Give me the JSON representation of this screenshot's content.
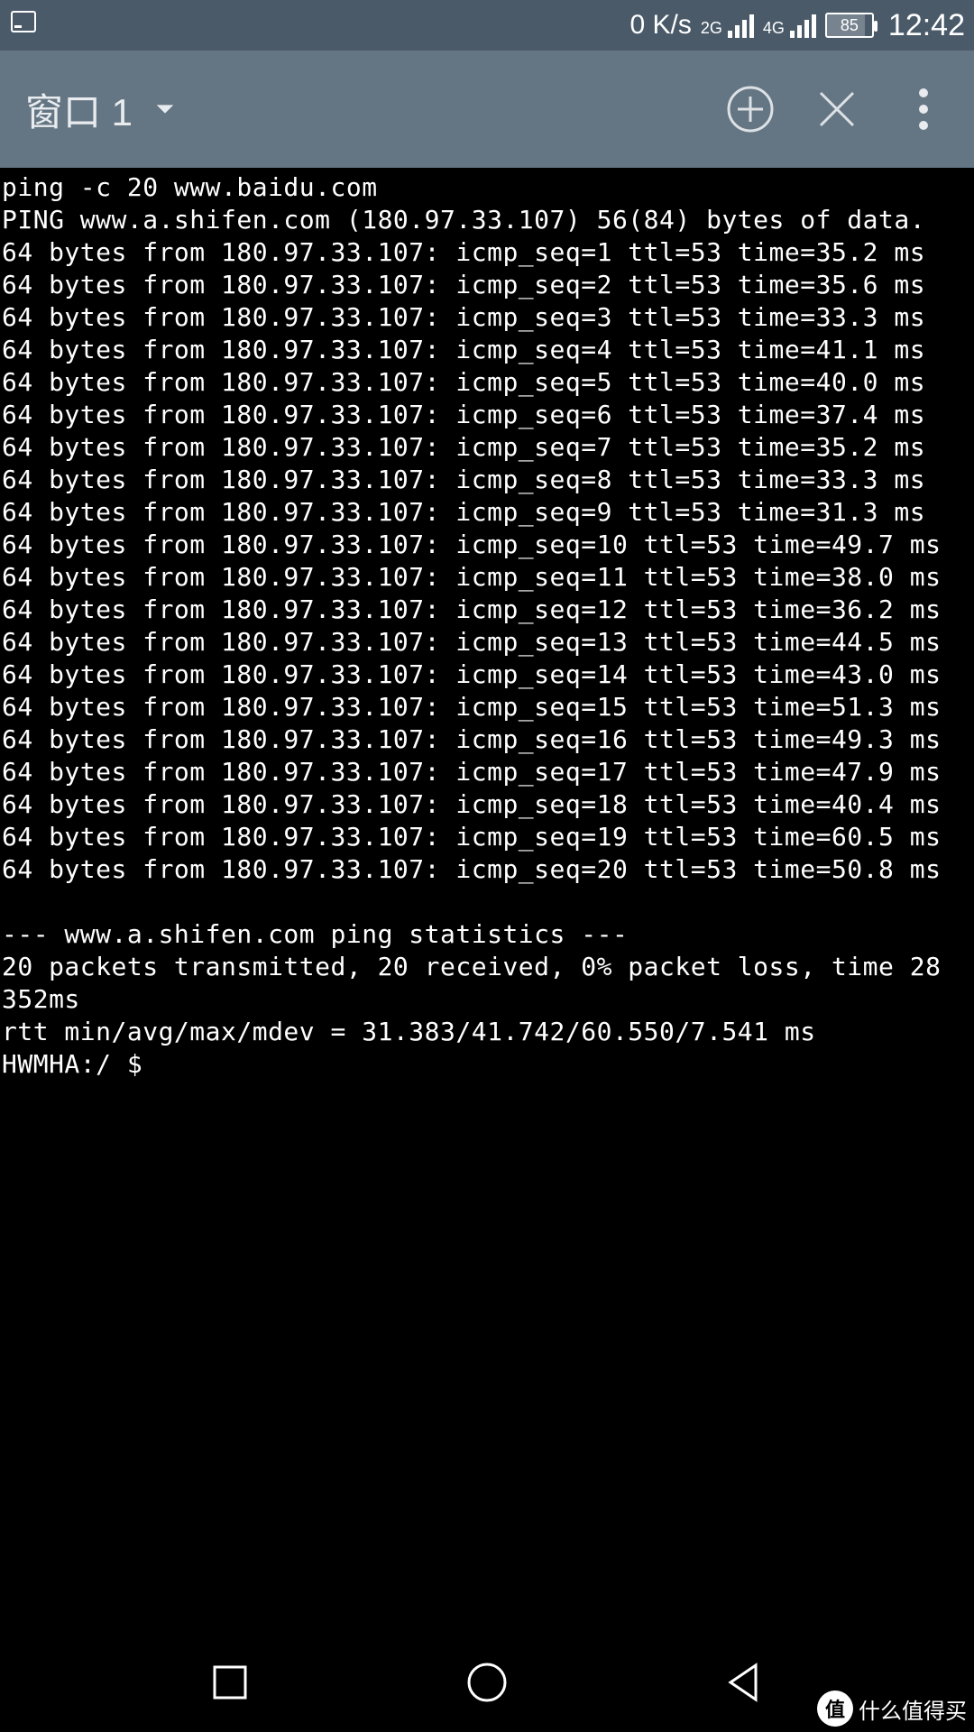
{
  "status": {
    "speed": "0 K/s",
    "sig1_label": "2G",
    "sig2_label": "4G",
    "battery_pct": "85",
    "time": "12:42"
  },
  "appbar": {
    "tab_label": "窗口 1"
  },
  "terminal": {
    "command": "ping -c 20 www.baidu.com",
    "resolved_line": "PING www.a.shifen.com (180.97.33.107) 56(84) bytes of data.",
    "from_ip": "180.97.33.107",
    "ttl": 53,
    "replies": [
      {
        "seq": 1,
        "time": "35.2"
      },
      {
        "seq": 2,
        "time": "35.6"
      },
      {
        "seq": 3,
        "time": "33.3"
      },
      {
        "seq": 4,
        "time": "41.1"
      },
      {
        "seq": 5,
        "time": "40.0"
      },
      {
        "seq": 6,
        "time": "37.4"
      },
      {
        "seq": 7,
        "time": "35.2"
      },
      {
        "seq": 8,
        "time": "33.3"
      },
      {
        "seq": 9,
        "time": "31.3"
      },
      {
        "seq": 10,
        "time": "49.7"
      },
      {
        "seq": 11,
        "time": "38.0"
      },
      {
        "seq": 12,
        "time": "36.2"
      },
      {
        "seq": 13,
        "time": "44.5"
      },
      {
        "seq": 14,
        "time": "43.0"
      },
      {
        "seq": 15,
        "time": "51.3"
      },
      {
        "seq": 16,
        "time": "49.3"
      },
      {
        "seq": 17,
        "time": "47.9"
      },
      {
        "seq": 18,
        "time": "40.4"
      },
      {
        "seq": 19,
        "time": "60.5"
      },
      {
        "seq": 20,
        "time": "50.8"
      }
    ],
    "stats_header": "--- www.a.shifen.com ping statistics ---",
    "stats_summary_a": "20 packets transmitted, 20 received, 0% packet loss, time 28",
    "stats_summary_b": "352ms",
    "rtt_line": "rtt min/avg/max/mdev = 31.383/41.742/60.550/7.541 ms",
    "prompt": "HWMHA:/ $ "
  },
  "watermark": {
    "badge": "值",
    "text": "什么值得买"
  }
}
